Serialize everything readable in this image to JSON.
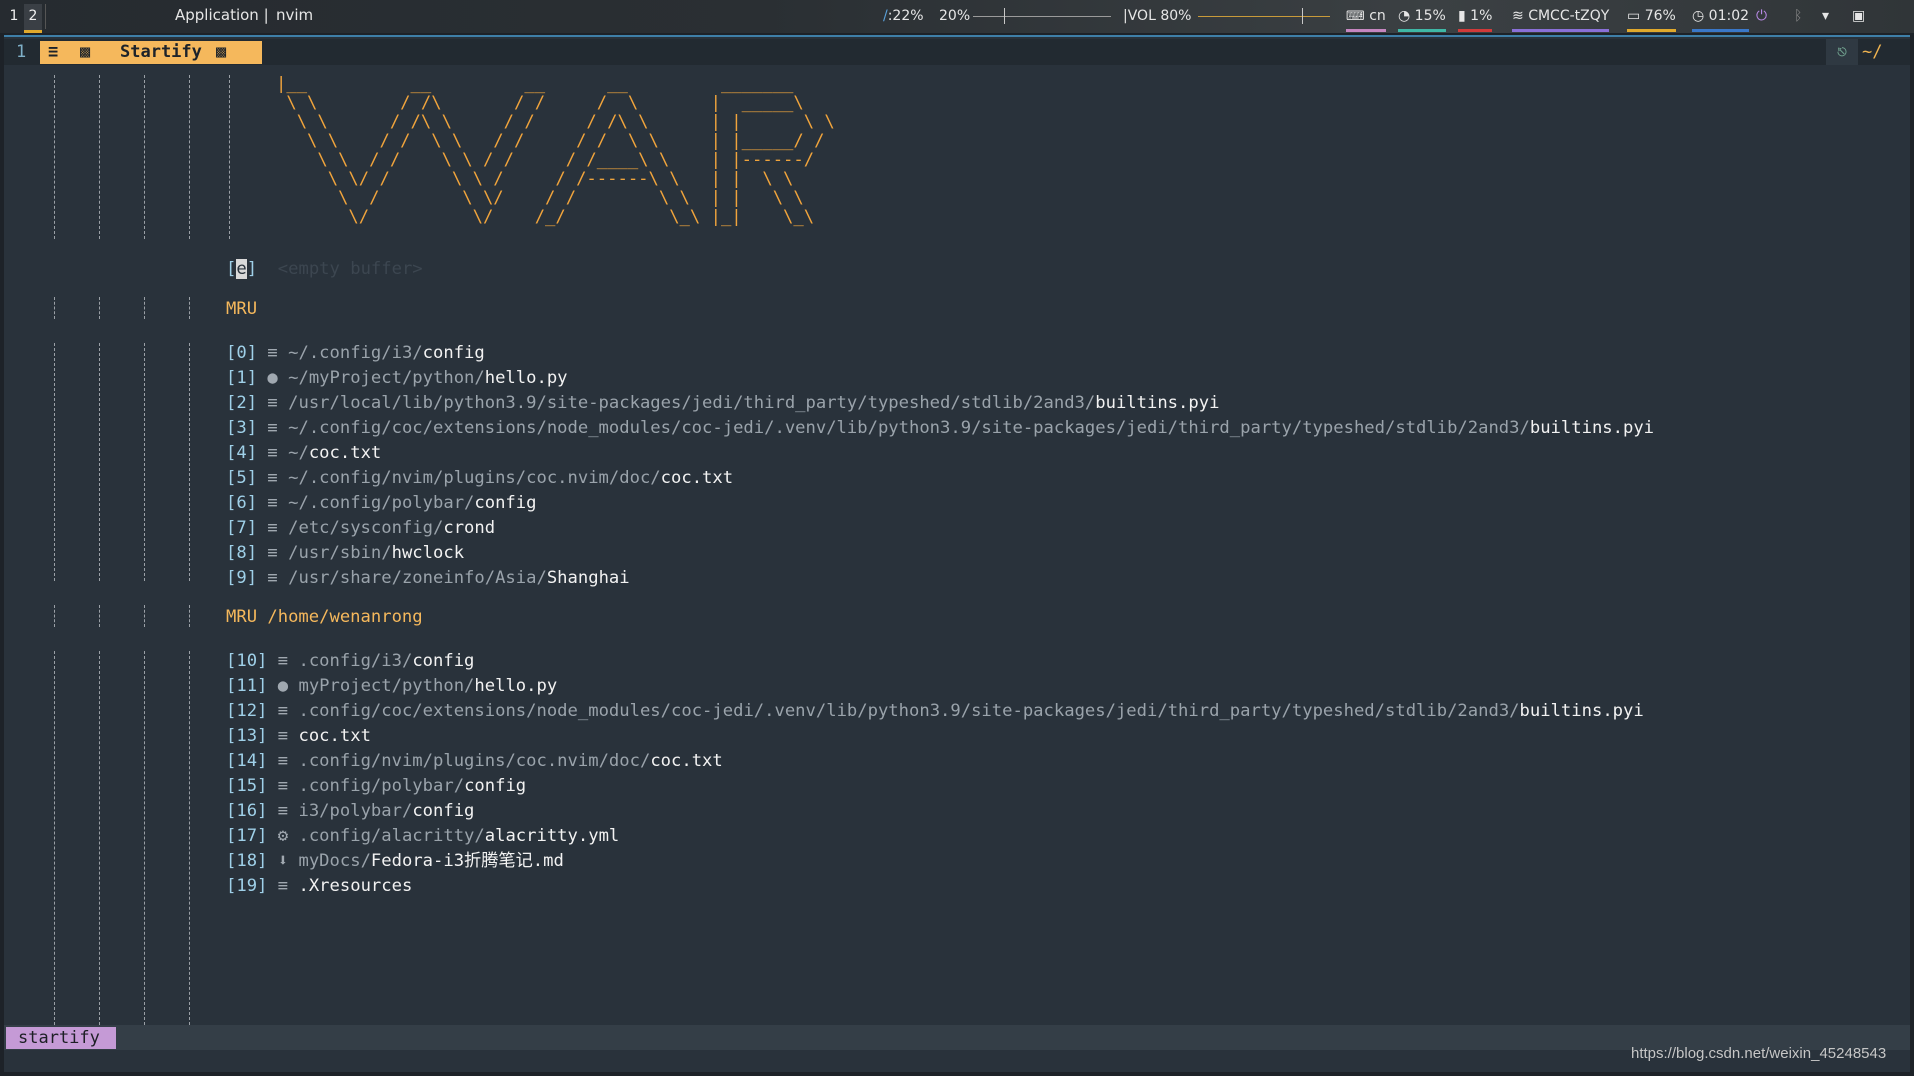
{
  "polybar": {
    "workspaces": [
      "1",
      "2"
    ],
    "active_workspace": "2",
    "window_title_prefix": "Application |",
    "window_title": "nvim",
    "brightness_label": ":22%",
    "media_label": "20%",
    "volume_label": "|VOL 80%",
    "keyboard_label": "cn",
    "cpu_label": "15%",
    "memory_label": "1%",
    "wifi_label": "CMCC-tZQY",
    "battery_label": "76%",
    "clock_label": "01:02",
    "brightness_fraction": 0.22,
    "volume_fraction": 0.8,
    "colors": {
      "keyboard": "#c586c0",
      "cpu": "#3fb8a6",
      "memory": "#d23a3a",
      "wifi": "#8a70d8",
      "battery": "#e0a92c",
      "clock": "#3a78c9"
    }
  },
  "tabline": {
    "tab_number": "1",
    "active_tab_label": "Startify",
    "cwd": "~/"
  },
  "startify": {
    "ascii_art": "|__          __         __      __         _______\n \\ \\        / /\\       / /     /  \\       |  _____\\\n  \\ \\      / /\\ \\     / /     / /\\ \\      | |      \\ \\\n   \\ \\    / /  \\ \\   / /     / /  \\ \\     | |_____/ /\n    \\ \\  / /    \\ \\ / /     / /____\\ \\    | |------/\n     \\ \\/ /      \\ \\ /     / /------\\ \\   | |  \\ \\\n      \\  /        \\ \\/    / /        \\ \\  | |   \\ \\\n       \\/          \\/    /_/          \\_\\ |_|    \\_\\",
    "empty_buffer": {
      "index": "e",
      "label": "<empty buffer>"
    },
    "mru_header": "MRU",
    "mru": [
      {
        "index": "[0]",
        "icon": "≡",
        "dir": "~/.config/i3/",
        "file": "config"
      },
      {
        "index": "[1]",
        "icon": "●",
        "dir": "~/myProject/python/",
        "file": "hello.py"
      },
      {
        "index": "[2]",
        "icon": "≡",
        "dir": "/usr/local/lib/python3.9/site-packages/jedi/third_party/typeshed/stdlib/2and3/",
        "file": "builtins.pyi"
      },
      {
        "index": "[3]",
        "icon": "≡",
        "dir": "~/.config/coc/extensions/node_modules/coc-jedi/.venv/lib/python3.9/site-packages/jedi/third_party/typeshed/stdlib/2and3/",
        "file": "builtins.pyi"
      },
      {
        "index": "[4]",
        "icon": "≡",
        "dir": "~/",
        "file": "coc.txt"
      },
      {
        "index": "[5]",
        "icon": "≡",
        "dir": "~/.config/nvim/plugins/coc.nvim/doc/",
        "file": "coc.txt"
      },
      {
        "index": "[6]",
        "icon": "≡",
        "dir": "~/.config/polybar/",
        "file": "config"
      },
      {
        "index": "[7]",
        "icon": "≡",
        "dir": "/etc/sysconfig/",
        "file": "crond"
      },
      {
        "index": "[8]",
        "icon": "≡",
        "dir": "/usr/sbin/",
        "file": "hwclock"
      },
      {
        "index": "[9]",
        "icon": "≡",
        "dir": "/usr/share/zoneinfo/Asia/",
        "file": "Shanghai"
      }
    ],
    "mru_cwd_header": "MRU /home/wenanrong",
    "mru_cwd": [
      {
        "index": "[10]",
        "icon": "≡",
        "dir": ".config/i3/",
        "file": "config"
      },
      {
        "index": "[11]",
        "icon": "●",
        "dir": "myProject/python/",
        "file": "hello.py"
      },
      {
        "index": "[12]",
        "icon": "≡",
        "dir": ".config/coc/extensions/node_modules/coc-jedi/.venv/lib/python3.9/site-packages/jedi/third_party/typeshed/stdlib/2and3/",
        "file": "builtins.pyi"
      },
      {
        "index": "[13]",
        "icon": "≡",
        "dir": "",
        "file": "coc.txt"
      },
      {
        "index": "[14]",
        "icon": "≡",
        "dir": ".config/nvim/plugins/coc.nvim/doc/",
        "file": "coc.txt"
      },
      {
        "index": "[15]",
        "icon": "≡",
        "dir": ".config/polybar/",
        "file": "config"
      },
      {
        "index": "[16]",
        "icon": "≡",
        "dir": "i3/polybar/",
        "file": "config"
      },
      {
        "index": "[17]",
        "icon": "⚙",
        "dir": ".config/alacritty/",
        "file": "alacritty.yml"
      },
      {
        "index": "[18]",
        "icon": "⬇",
        "dir": "myDocs/",
        "file": "Fedora-i3折腾笔记.md"
      },
      {
        "index": "[19]",
        "icon": "≡",
        "dir": "",
        "file": ".Xresources"
      }
    ]
  },
  "statusline": {
    "mode": "startify"
  },
  "watermark": "https://blog.csdn.net/weixin_45248543"
}
